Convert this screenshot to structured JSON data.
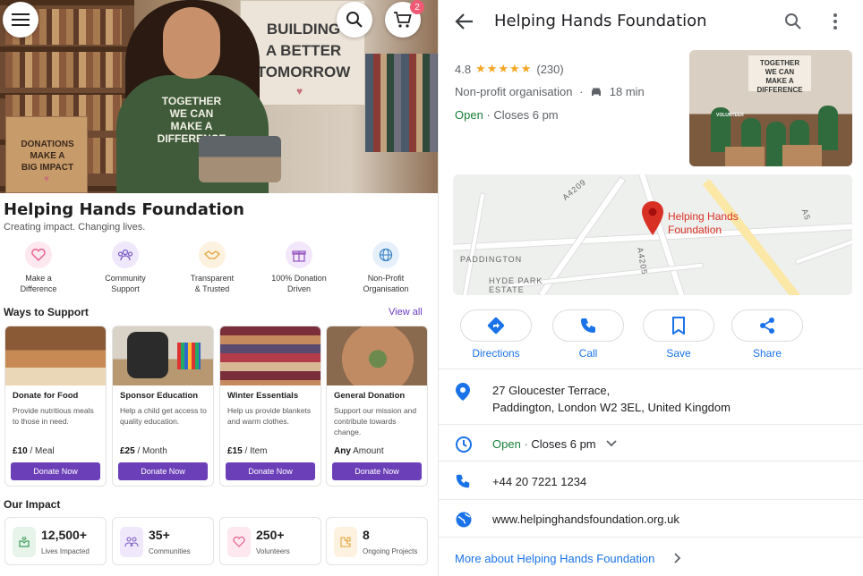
{
  "left": {
    "hero": {
      "banner_text": "BUILDING\nA BETTER\nTOMORROW",
      "shirt_text": "TOGETHER\nWE CAN\nMAKE A\nDIFFERENCE",
      "box_text": "DONATIONS\nMAKE A\nBIG IMPACT",
      "cart_count": "2"
    },
    "org_title": "Helping Hands Foundation",
    "org_subtitle": "Creating impact. Changing lives.",
    "features": [
      {
        "label": "Make a\nDifference",
        "icon": "heart-icon",
        "color": "#e85d8a",
        "bg": "#fde8ef"
      },
      {
        "label": "Community\nSupport",
        "icon": "community-icon",
        "color": "#7b5cc4",
        "bg": "#efe8fb"
      },
      {
        "label": "Transparent\n& Trusted",
        "icon": "handshake-icon",
        "color": "#e2a23b",
        "bg": "#fdf2df"
      },
      {
        "label": "100% Donation\nDriven",
        "icon": "gift-icon",
        "color": "#9b5cc4",
        "bg": "#f3e8fb"
      },
      {
        "label": "Non-Profit\nOrganisation",
        "icon": "globe-icon",
        "color": "#3b82c4",
        "bg": "#e6f0fb"
      }
    ],
    "ways_title": "Ways to Support",
    "view_all": "View all",
    "cards": [
      {
        "title": "Donate for Food",
        "desc": "Provide nutritious meals to those in need.",
        "amount": "£10",
        "unit": "/ Meal",
        "button": "Donate Now"
      },
      {
        "title": "Sponsor Education",
        "desc": "Help a child get access to quality education.",
        "amount": "£25",
        "unit": "/ Month",
        "button": "Donate Now"
      },
      {
        "title": "Winter Essentials",
        "desc": "Help us provide blankets and warm clothes.",
        "amount": "£15",
        "unit": "/ Item",
        "button": "Donate Now"
      },
      {
        "title": "General Donation",
        "desc": "Support our mission and contribute towards change.",
        "amount": "Any",
        "unit": "Amount",
        "button": "Donate Now"
      }
    ],
    "impact_title": "Our Impact",
    "impact": [
      {
        "value": "12,500+",
        "label": "Lives Impacted",
        "color": "#3f9b5a",
        "bg": "#e6f4ea"
      },
      {
        "value": "35+",
        "label": "Communities",
        "color": "#7b5cc4",
        "bg": "#efe8fb"
      },
      {
        "value": "250+",
        "label": "Volunteers",
        "color": "#e85d8a",
        "bg": "#fde8ef"
      },
      {
        "value": "8",
        "label": "Ongoing Projects",
        "color": "#e2a23b",
        "bg": "#fdf2df"
      }
    ]
  },
  "right": {
    "title": "Helping Hands Foundation",
    "rating": "4.8",
    "stars": 4.8,
    "reviews": "(230)",
    "category": "Non-profit organisation",
    "drive_time": "18 min",
    "open_status": "Open",
    "closes": "Closes 6 pm",
    "thumb_sign": "TOGETHER\nWE CAN\nMAKE A DIFFERENCE",
    "thumb_vest": "VOLUNTEER",
    "map": {
      "pin_label": "Helping Hands\nFoundation",
      "street_labels": [
        "PADDINGTON",
        "HYDE PARK",
        "ESTATE",
        "A4209",
        "A4205",
        "A5"
      ],
      "hyde_park_estate": "HYDE PARK\nESTATE"
    },
    "actions": [
      {
        "label": "Directions",
        "icon": "directions-icon"
      },
      {
        "label": "Call",
        "icon": "phone-icon"
      },
      {
        "label": "Save",
        "icon": "bookmark-icon"
      },
      {
        "label": "Share",
        "icon": "share-icon"
      }
    ],
    "address_line1": "27 Gloucester Terrace,",
    "address_line2": "Paddington, London W2 3EL, United Kingdom",
    "hours_open": "Open",
    "hours_close": "Closes 6 pm",
    "phone": "+44 20 7221 1234",
    "website": "www.helpinghandsfoundation.org.uk",
    "more_link": "More about Helping Hands Foundation",
    "accent": "#1a73e8"
  }
}
